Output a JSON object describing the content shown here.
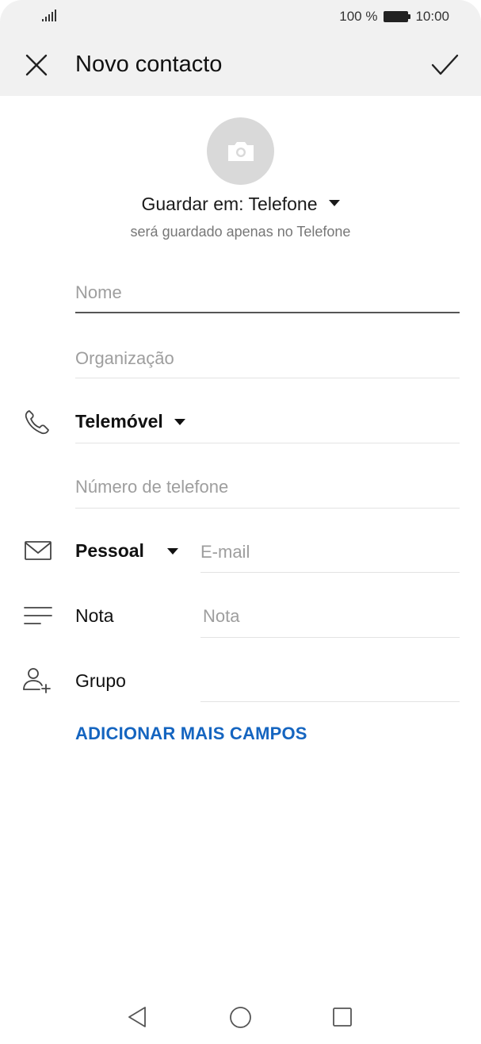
{
  "status_bar": {
    "battery_text": "100 %",
    "time": "10:00"
  },
  "toolbar": {
    "title": "Novo contacto"
  },
  "save_location": {
    "label": "Guardar em: Telefone",
    "note": "será guardado apenas no Telefone"
  },
  "fields": {
    "name_placeholder": "Nome",
    "organization_placeholder": "Organização",
    "phone_type": "Telemóvel",
    "phone_placeholder": "Número de telefone",
    "email_type": "Pessoal",
    "email_placeholder": "E-mail",
    "note_label": "Nota",
    "note_placeholder": "Nota",
    "group_label": "Grupo"
  },
  "actions": {
    "add_more_fields": "ADICIONAR MAIS CAMPOS"
  },
  "colors": {
    "accent": "#1565c0",
    "header_bg": "#f1f1f1",
    "avatar_bg": "#d9d9d9"
  },
  "icons": [
    "signal-icon",
    "battery-icon",
    "close-icon",
    "check-icon",
    "camera-icon",
    "phone-icon",
    "email-icon",
    "note-icon",
    "group-icon",
    "nav-back-icon",
    "nav-home-icon",
    "nav-recents-icon"
  ]
}
